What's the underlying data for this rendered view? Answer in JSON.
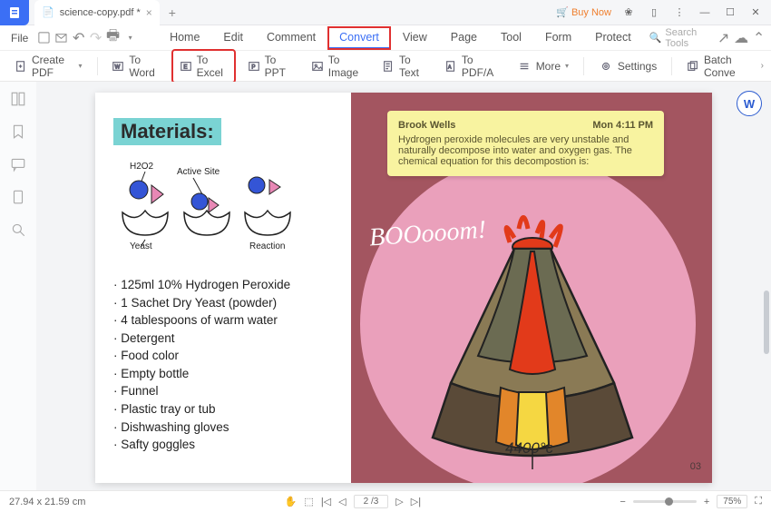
{
  "titlebar": {
    "filename": "science-copy.pdf *",
    "buy_now": "Buy Now"
  },
  "menubar": {
    "file": "File",
    "tabs": [
      "Home",
      "Edit",
      "Comment",
      "Convert",
      "View",
      "Page",
      "Tool",
      "Form",
      "Protect"
    ],
    "search_placeholder": "Search Tools"
  },
  "toolbar": {
    "create_pdf": "Create PDF",
    "to_word": "To Word",
    "to_excel": "To Excel",
    "to_ppt": "To PPT",
    "to_image": "To Image",
    "to_text": "To Text",
    "to_pdfa": "To PDF/A",
    "more": "More",
    "settings": "Settings",
    "batch_convert": "Batch Conve"
  },
  "document": {
    "materials_heading": "Materials:",
    "diagram_labels": {
      "h2o2": "H2O2",
      "active_site": "Active Site",
      "yeast": "Yeast",
      "reaction": "Reaction"
    },
    "materials_list": [
      "125ml 10% Hydrogen Peroxide",
      "1 Sachet Dry Yeast (powder)",
      "4 tablespoons of warm water",
      "Detergent",
      "Food color",
      "Empty bottle",
      "Funnel",
      "Plastic tray or tub",
      "Dishwashing gloves",
      "Safty goggles"
    ],
    "note": {
      "author": "Brook Wells",
      "time": "Mon 4:11 PM",
      "text": "Hydrogen peroxide molecules are very unstable and naturally decompose into water and oxygen gas. The chemical equation for this decompostion is:"
    },
    "boom_text": "BOOooom!",
    "temperature": "4400°c",
    "page_number": "03"
  },
  "statusbar": {
    "dimensions": "27.94 x 21.59 cm",
    "page_indicator": "2 /3",
    "zoom_pct": "75%"
  }
}
